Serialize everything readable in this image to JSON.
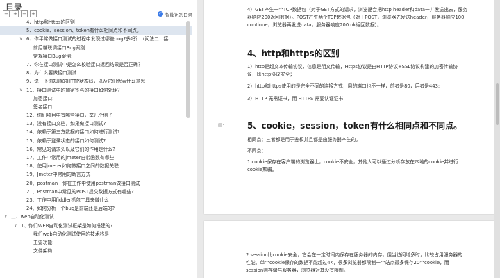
{
  "sidebar": {
    "title": "目录",
    "smart_label": "智能识别目录",
    "items": [
      {
        "text": "4、http和https的区别",
        "indent": 38,
        "caret": ""
      },
      {
        "text": "5、cookie、session、token有什么相同点和不同点。",
        "indent": 38,
        "caret": "",
        "selected": true
      },
      {
        "text": "6、你平常做接口测试的过程中发现过哪些bug?多吗？（问法二：接...",
        "indent": 38,
        "caret": "∨"
      },
      {
        "text": "前后端联调接口Bug案例:",
        "indent": 48,
        "caret": ""
      },
      {
        "text": "常规接口Bug案例:",
        "indent": 48,
        "caret": ""
      },
      {
        "text": "7、你在接口测试中是怎么校验接口返回结果是否正确？",
        "indent": 38,
        "caret": ""
      },
      {
        "text": "8、为什么要做接口测试",
        "indent": 38,
        "caret": ""
      },
      {
        "text": "9、说一下你知道的HTTP状态码，以及它们代表什么意思",
        "indent": 38,
        "caret": ""
      },
      {
        "text": "11、接口测试中的加密签名的接口如何处理？",
        "indent": 38,
        "caret": "∨"
      },
      {
        "text": "加密接口:",
        "indent": 48,
        "caret": ""
      },
      {
        "text": "签名接口:",
        "indent": 48,
        "caret": ""
      },
      {
        "text": "12、你们项目中有哪些接口，举几个例子",
        "indent": 38,
        "caret": ""
      },
      {
        "text": "13、没有接口文档，如果做接口测试?",
        "indent": 38,
        "caret": ""
      },
      {
        "text": "14、依赖于第三方数据的接口如何进行测试?",
        "indent": 38,
        "caret": ""
      },
      {
        "text": "15、依赖于登录状态的接口如何测试?",
        "indent": 38,
        "caret": ""
      },
      {
        "text": "16、常见的请求头以及它们的作用是什么?",
        "indent": 38,
        "caret": ""
      },
      {
        "text": "17、工作中常用的jmeter自带函数有哪些",
        "indent": 38,
        "caret": ""
      },
      {
        "text": "18、使用jmeter如何做接口之间的数据关联",
        "indent": 38,
        "caret": ""
      },
      {
        "text": "19、Jmeter中常用的断言方式",
        "indent": 38,
        "caret": ""
      },
      {
        "text": "20、postman　你在工作中使用postman做接口测试",
        "indent": 38,
        "caret": ""
      },
      {
        "text": "21、Postman中常见的POST提交数据方式有哪些?",
        "indent": 38,
        "caret": ""
      },
      {
        "text": "23、工作中用fiddler抓包工具来做什么",
        "indent": 38,
        "caret": ""
      },
      {
        "text": "24、如何分析一个bug是前端还是后端的?",
        "indent": 38,
        "caret": ""
      },
      {
        "text": "二、web自动化测试",
        "indent": 16,
        "caret": "∨"
      },
      {
        "text": "1、你们WEB自动化测试框架是如何搭建的?",
        "indent": 30,
        "caret": "∨"
      },
      {
        "text": "我们web自动化测试使用的技术栈是:",
        "indent": 48,
        "caret": ""
      },
      {
        "text": "主要功能:",
        "indent": 48,
        "caret": ""
      },
      {
        "text": "文件架构:",
        "indent": 48,
        "caret": ""
      }
    ]
  },
  "doc": {
    "get_para_l1": "4）GET产生一个TCP数据包（对于GET方式的请求，浏览器会把http header和data一并发送出去，服务",
    "get_para_l2": "器响应200返回数据）。POST产生两个TCP数据包（对于POST，浏览器先发送header，服务器响应100",
    "get_para_l3": "continue，浏览器再发送data，服务器响应200 ok返回数据）。",
    "h_http": "4、http和https的区别",
    "http_1_l1": "1）http是超文本传输协议，信息是明文传输，Https协议是由HTTP协议+SSL协议构建的加密传输协",
    "http_1_l2": "议，比http协议安全；",
    "http_2": "2）http和https使用的是完全不同的连接方式，用的端口也不一样，前者是80，后者是443;",
    "http_3": "3）HTTP 无需证书，而 HTTPS 需要认证证书",
    "h_cookie": "5、cookie，session，token有什么相同点和不同点。",
    "same": "相同点：三者都是用于鉴权并且都是由服务器产生的。",
    "diff": "不同点：",
    "diff_1_l1": "1.cookie保存在客户端的浏览器上，cookie不安全，其他人可以通过分析存放在本地的cookie并进行",
    "diff_1_l2": "cookie欺骗。",
    "p2_l1": "2.session比cookie安全，它会在一定时间内保存在服务器的内存，但当访问增多时，比较占用服务器的",
    "p2_l2": "性能。单个cookie保存的数据不能超过4K，很多浏览器都限制一个站点最多保存20个cookie，而",
    "p2_l3": "session则存储与服务器，浏览器对其没有限制。"
  },
  "icons": {
    "margin_icon": "document-margin-icon"
  }
}
